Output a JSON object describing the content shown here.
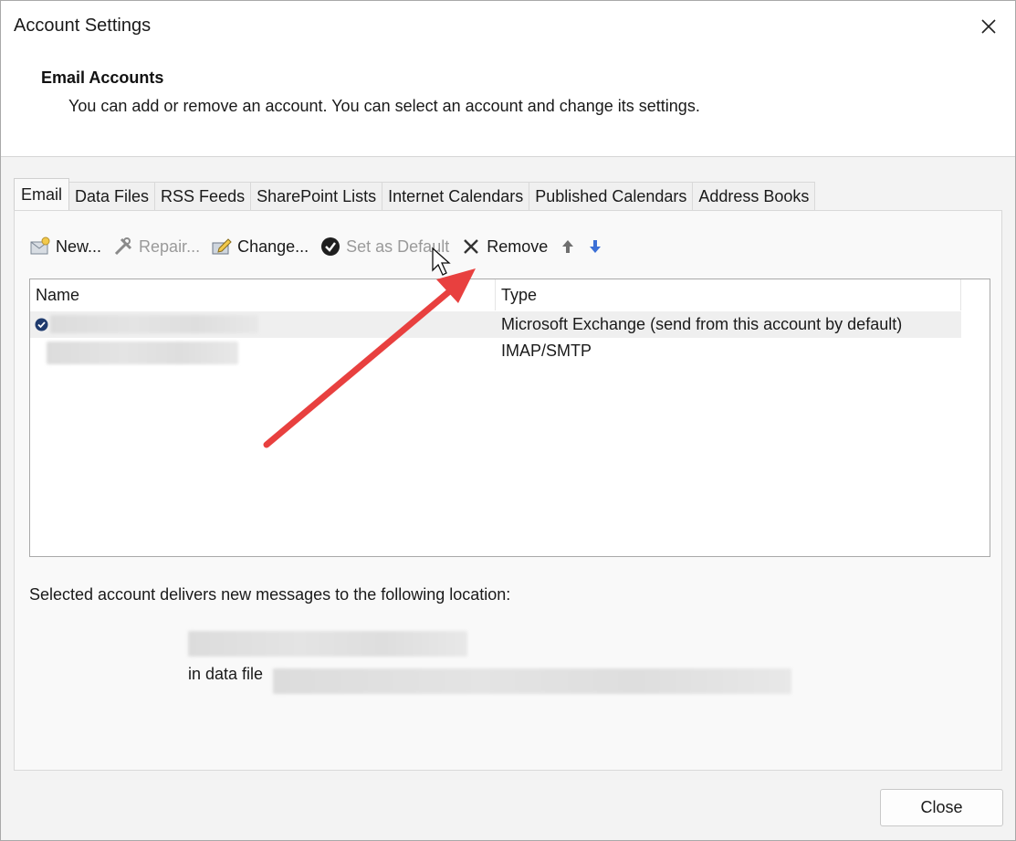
{
  "window": {
    "title": "Account Settings"
  },
  "header": {
    "title": "Email Accounts",
    "description": "You can add or remove an account. You can select an account and change its settings."
  },
  "tabs": [
    {
      "label": "Email",
      "active": true
    },
    {
      "label": "Data Files"
    },
    {
      "label": "RSS Feeds"
    },
    {
      "label": "SharePoint Lists"
    },
    {
      "label": "Internet Calendars"
    },
    {
      "label": "Published Calendars"
    },
    {
      "label": "Address Books"
    }
  ],
  "toolbar": {
    "new": "New...",
    "repair": "Repair...",
    "change": "Change...",
    "set_default": "Set as Default",
    "remove": "Remove"
  },
  "list": {
    "columns": {
      "name": "Name",
      "type": "Type"
    },
    "rows": [
      {
        "type": "Microsoft Exchange (send from this account by default)",
        "is_default": true,
        "selected": true
      },
      {
        "type": "IMAP/SMTP",
        "is_default": false,
        "selected": false
      }
    ]
  },
  "details": {
    "delivers_label": "Selected account delivers new messages to the following location:",
    "in_data_file_label": "in data file"
  },
  "footer": {
    "close": "Close"
  },
  "colors": {
    "annotation_arrow": "#e8403f",
    "up_arrow": "#6f6f6f",
    "down_arrow": "#3b6fd6"
  }
}
